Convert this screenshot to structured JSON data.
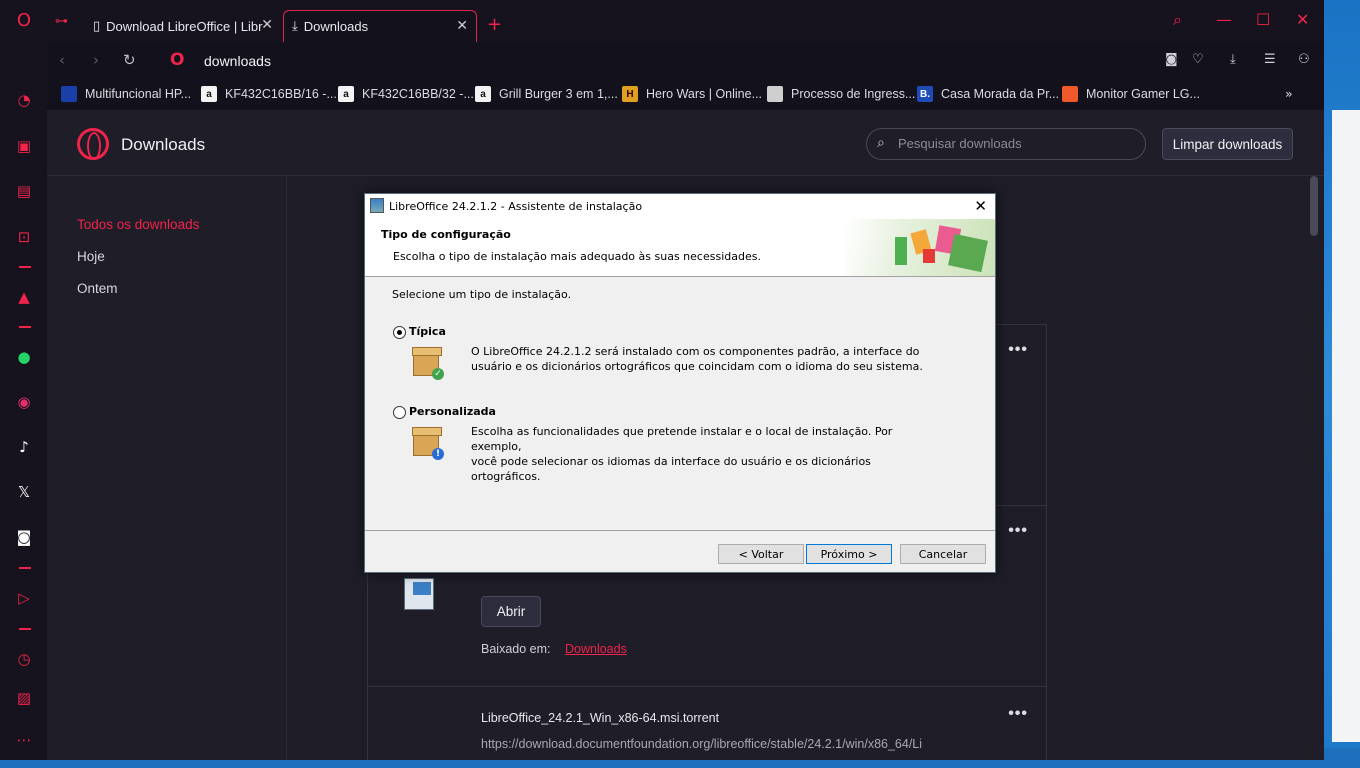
{
  "browser": {
    "tabs": [
      {
        "label": "Download LibreOffice | Libr",
        "icon": "page-icon"
      },
      {
        "label": "Downloads",
        "icon": "download-icon"
      }
    ],
    "address": "downloads"
  },
  "bookmarks": [
    {
      "label": "Multifuncional HP...",
      "color": "#1a3fa8"
    },
    {
      "label": "KF432C16BB/16 -...",
      "color": "#f3f3f3"
    },
    {
      "label": "KF432C16BB/32 -...",
      "color": "#f3f3f3"
    },
    {
      "label": "Grill Burger 3 em 1,...",
      "color": "#f3f3f3"
    },
    {
      "label": "Hero Wars | Online...",
      "color": "#e0a020"
    },
    {
      "label": "Processo de Ingress...",
      "color": "#cfcfcf"
    },
    {
      "label": "Casa Morada da Pr...",
      "color": "#1e4bb5"
    },
    {
      "label": "Monitor Gamer LG...",
      "color": "#f2592a"
    }
  ],
  "downloads_page": {
    "title": "Downloads",
    "search_placeholder": "Pesquisar downloads",
    "clear_label": "Limpar downloads",
    "nav": [
      "Todos os downloads",
      "Hoje",
      "Ontem"
    ],
    "card2": {
      "open_label": "Abrir",
      "saved_in_label": "Baixado em:",
      "saved_in_link": "Downloads"
    },
    "card3": {
      "file_name": "LibreOffice_24.2.1_Win_x86-64.msi.torrent",
      "url": "https://download.documentfoundation.org/libreoffice/stable/24.2.1/win/x86_64/Li"
    }
  },
  "dialog": {
    "title": "LibreOffice 24.2.1.2 - Assistente de instalação",
    "heading": "Tipo de configuração",
    "subheading": "Escolha o tipo de instalação mais adequado às suas necessidades.",
    "prompt": "Selecione um tipo de instalação.",
    "options": [
      {
        "label": "Típica",
        "selected": true,
        "desc1": "O LibreOffice 24.2.1.2 será instalado com os componentes padrão, a interface do",
        "desc2": "usuário e os dicionários ortográficos que coincidam com o idioma do seu sistema."
      },
      {
        "label": "Personalizada",
        "selected": false,
        "desc1": "Escolha as funcionalidades que pretende instalar e o local de instalação. Por exemplo,",
        "desc2": "você pode selecionar os idiomas da interface do usuário e os dicionários ortográficos."
      }
    ],
    "buttons": {
      "back": "< Voltar",
      "next": "Próximo >",
      "cancel": "Cancelar"
    }
  },
  "colors": {
    "accent": "#f0234b",
    "dialog_bg": "#f0f0f0"
  }
}
